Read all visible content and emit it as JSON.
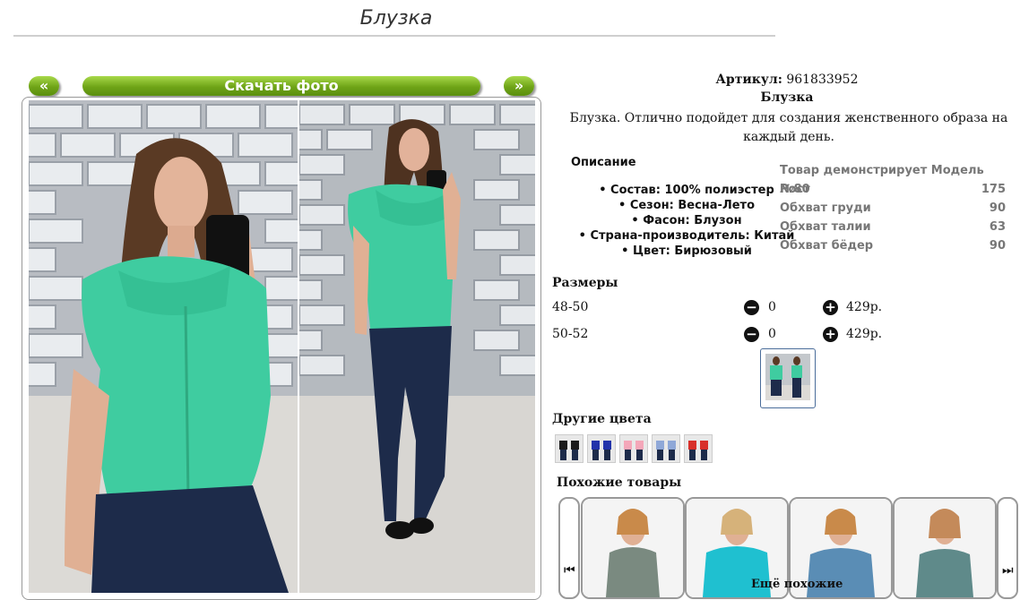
{
  "page": {
    "title": "Блузка"
  },
  "gallery": {
    "prev_label": "«",
    "download_label": "Скачать фото",
    "next_label": "»"
  },
  "product": {
    "article_label": "Артикул:",
    "article_value": "961833952",
    "name": "Блузка",
    "short_description": "Блузка. Отлично подойдет для создания женственного образа на каждый день."
  },
  "description": {
    "header": "Описание",
    "items": [
      "Состав: 100% полиэстер",
      "Сезон: Весна-Лето",
      "Фасон: Блузон",
      "Страна-производитель: Китай",
      "Цвет: Бирюзовый"
    ]
  },
  "model_params": {
    "header": "Товар демонстрирует Модель №80",
    "rows": [
      {
        "label": "Рост",
        "value": "175"
      },
      {
        "label": "Обхват груди",
        "value": "90"
      },
      {
        "label": "Обхват талии",
        "value": "63"
      },
      {
        "label": "Обхват бёдер",
        "value": "90"
      }
    ]
  },
  "sizes": {
    "header": "Размеры",
    "rows": [
      {
        "size": "48-50",
        "qty": "0",
        "price": "429р."
      },
      {
        "size": "50-52",
        "qty": "0",
        "price": "429р."
      }
    ]
  },
  "other_colors": {
    "header": "Другие цвета",
    "swatches": [
      "#1b1b1b",
      "#2233aa",
      "#f4a7b9",
      "#8fa8d8",
      "#d8302a"
    ]
  },
  "similar": {
    "header": "Похожие товары"
  },
  "footer": {
    "more_text": "Ещё похожие"
  },
  "colors": {
    "accent_green": "#6fa417",
    "top_turquoise": "#3fcca0",
    "jeans": "#1d2b4a"
  }
}
